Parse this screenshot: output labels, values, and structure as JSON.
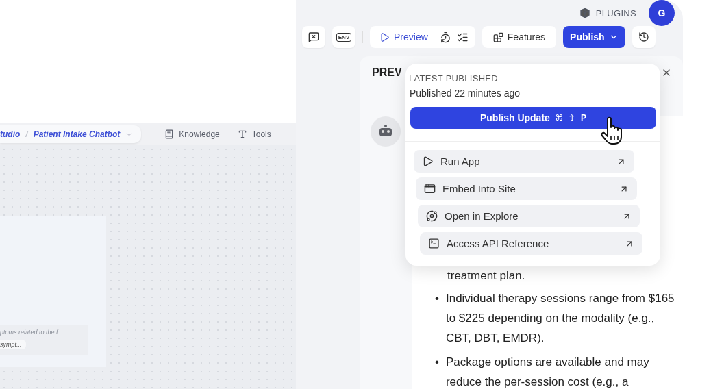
{
  "left_pane": {
    "breadcrumb": {
      "parent": "tudio",
      "separator": "/",
      "current": "Patient Intake Chatbot"
    },
    "nav": [
      {
        "label": "Knowledge",
        "kind": "book"
      },
      {
        "label": "Tools",
        "kind": "tool"
      }
    ],
    "node_card": {
      "hint": "ptoms related to the f",
      "value": "sympt..."
    }
  },
  "top_bar": {
    "plugins": "PLUGINS",
    "avatar": "G"
  },
  "toolbar": {
    "env_label": "ENV",
    "preview": "Preview",
    "features": "Features",
    "publish": "Publish"
  },
  "preview_panel": {
    "title": "PREV",
    "message": {
      "lead": "treatment plan.",
      "bullet_marker": "•",
      "bullets": [
        "Individual therapy sessions range from $165 to $225 depending on the modality (e.g., CBT, DBT, EMDR).",
        "Package options are available and may reduce the per-session cost (e.g., a"
      ]
    }
  },
  "publish_menu": {
    "heading": "LATEST PUBLISHED",
    "status": "Published 22 minutes ago",
    "button": {
      "label": "Publish Update",
      "keys": [
        "⌘",
        "⇧",
        "P"
      ]
    },
    "items": [
      {
        "label": "Run App",
        "kind": "play"
      },
      {
        "label": "Embed Into Site",
        "kind": "embed"
      },
      {
        "label": "Open in Explore",
        "kind": "explore"
      },
      {
        "label": "Access API Reference",
        "kind": "terminal"
      }
    ]
  }
}
